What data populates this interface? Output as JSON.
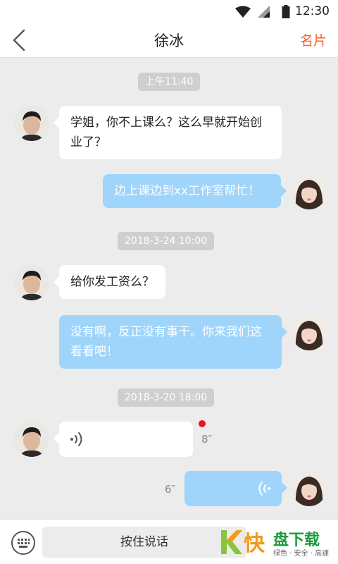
{
  "status_bar": {
    "time": "12:30"
  },
  "header": {
    "title": "徐冰",
    "right_action": "名片"
  },
  "timestamps": [
    "上午11:40",
    "2018-3-24  10:00",
    "2018-3-20  18:00"
  ],
  "messages": [
    {
      "from": "other",
      "text": "学姐，你不上课么？这么早就开始创业了？"
    },
    {
      "from": "me",
      "text": "边上课边到xx工作室帮忙！"
    },
    {
      "from": "other",
      "text": "给你发工资么？"
    },
    {
      "from": "me",
      "text": "没有啊，反正没有事干。你来我们这看看吧！"
    },
    {
      "from": "other",
      "type": "voice",
      "duration": "8″",
      "unread": true
    },
    {
      "from": "me",
      "type": "voice",
      "duration": "6″"
    }
  ],
  "footer": {
    "hold_to_talk": "按住说话"
  },
  "watermark": {
    "mark": "快",
    "name": "盘下载",
    "slogan": "绿色 · 安全 · 高速"
  }
}
